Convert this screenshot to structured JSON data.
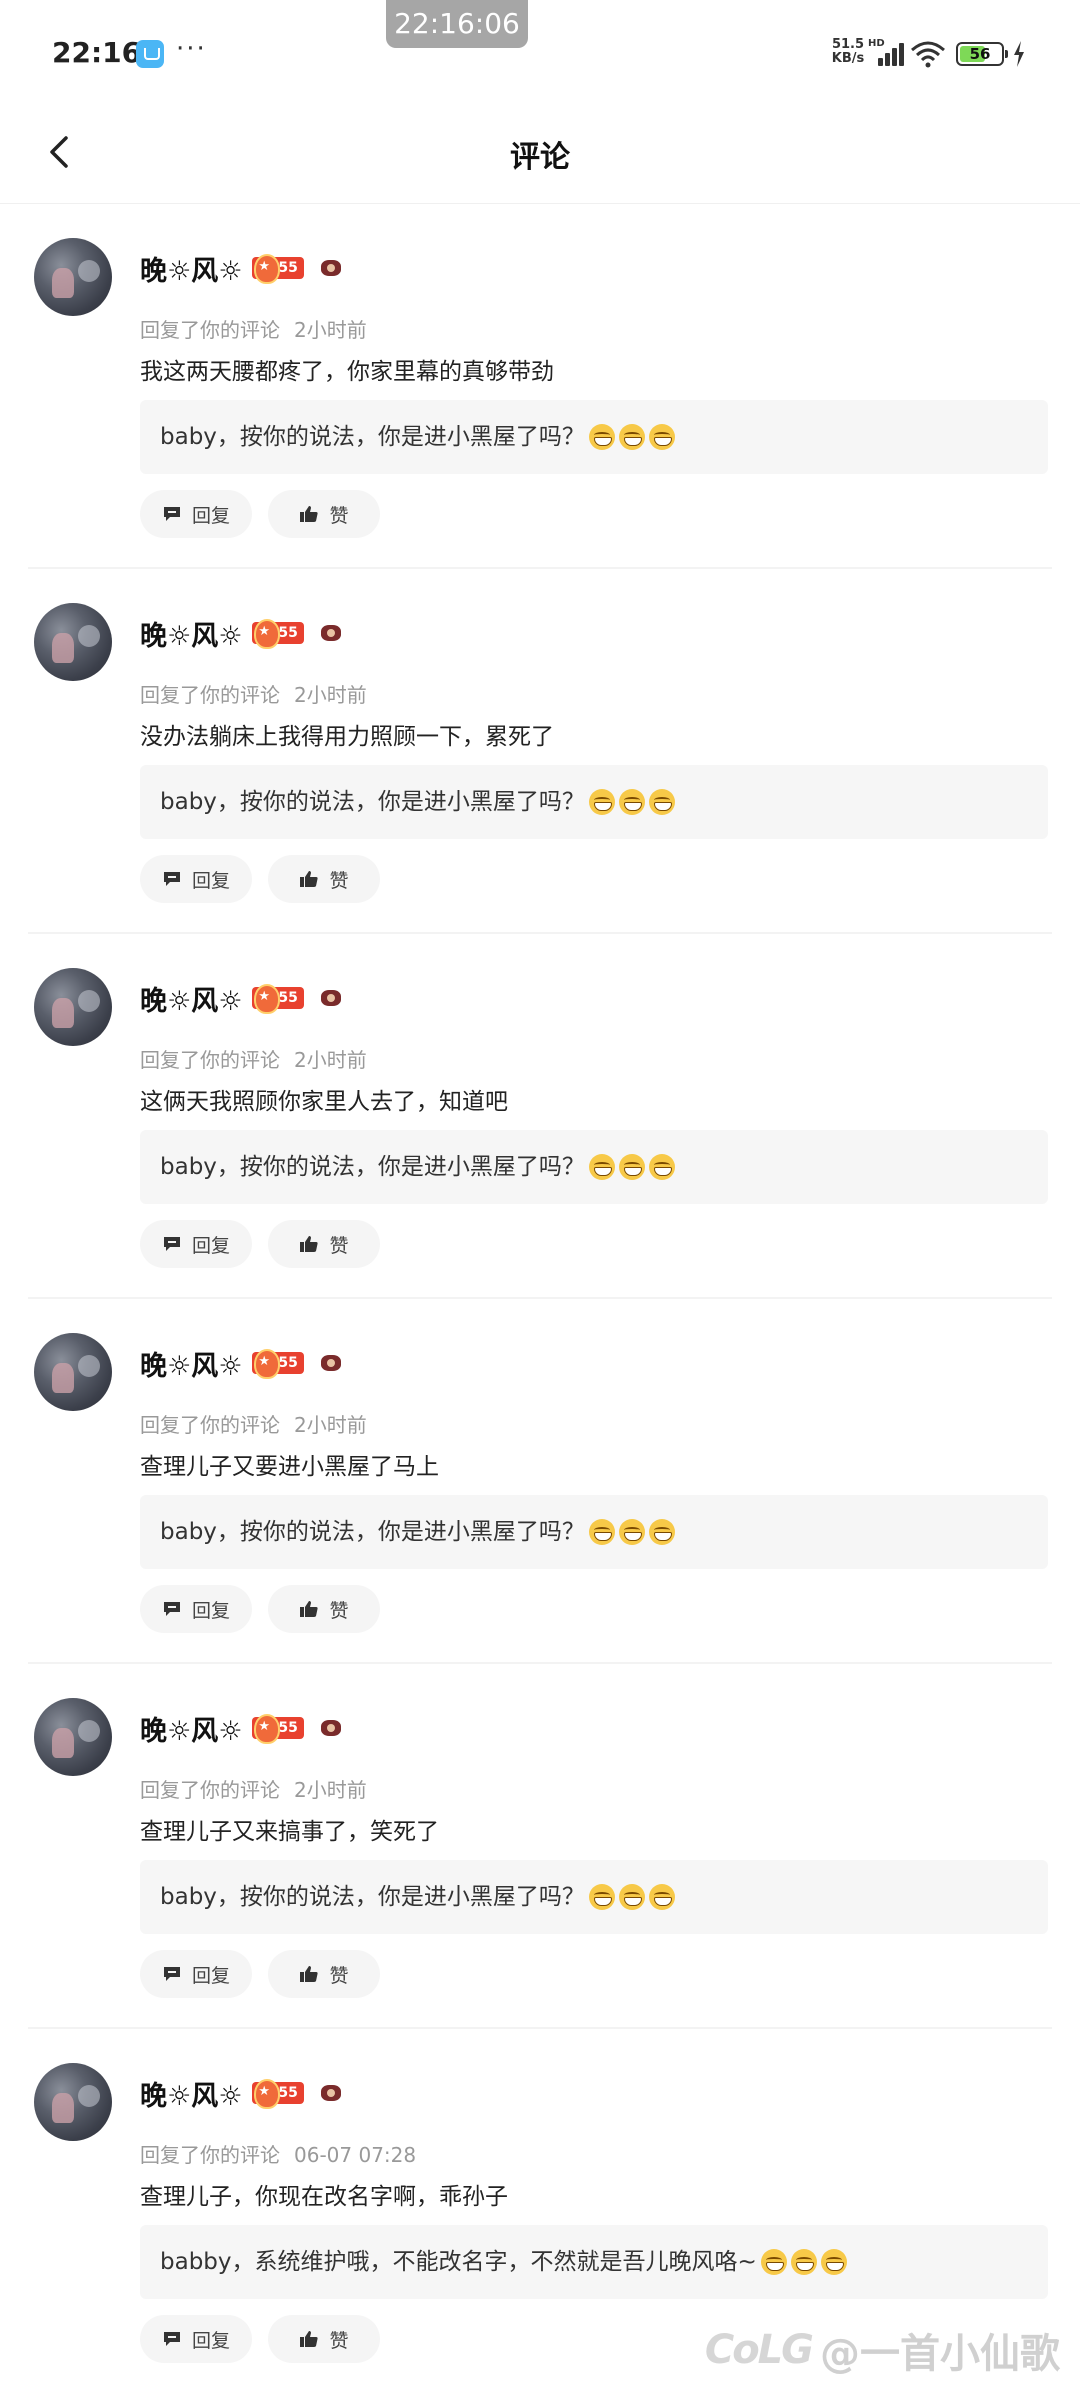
{
  "status_bar": {
    "time": "22:16",
    "overlay_time": "22:16:06",
    "more": "···",
    "net_speed": "51.5",
    "net_unit": "KB/s",
    "hd": "HD",
    "battery": "56"
  },
  "header": {
    "title": "评论"
  },
  "labels": {
    "reply": "回复",
    "like": "赞"
  },
  "comments": [
    {
      "username": "晚☼风☼",
      "level": "55",
      "meta": "回复了你的评论",
      "time": "2小时前",
      "text": "我这两天腰都疼了，你家里幕的真够带劲",
      "quote": "baby，按你的说法，你是进小黑屋了吗？"
    },
    {
      "username": "晚☼风☼",
      "level": "55",
      "meta": "回复了你的评论",
      "time": "2小时前",
      "text": "没办法躺床上我得用力照顾一下，累死了",
      "quote": "baby，按你的说法，你是进小黑屋了吗？"
    },
    {
      "username": "晚☼风☼",
      "level": "55",
      "meta": "回复了你的评论",
      "time": "2小时前",
      "text": "这俩天我照顾你家里人去了，知道吧",
      "quote": "baby，按你的说法，你是进小黑屋了吗？"
    },
    {
      "username": "晚☼风☼",
      "level": "55",
      "meta": "回复了你的评论",
      "time": "2小时前",
      "text": "查理儿子又要进小黑屋了马上",
      "quote": "baby，按你的说法，你是进小黑屋了吗？"
    },
    {
      "username": "晚☼风☼",
      "level": "55",
      "meta": "回复了你的评论",
      "time": "2小时前",
      "text": "查理儿子又来搞事了，笑死了",
      "quote": "baby，按你的说法，你是进小黑屋了吗？"
    },
    {
      "username": "晚☼风☼",
      "level": "55",
      "meta": "回复了你的评论",
      "time": "06-07 07:28",
      "text": "查理儿子，你现在改名字啊，乖孙子",
      "quote": "babby，系统维护哦，不能改名字，不然就是吾儿晚风咯~"
    }
  ],
  "watermark": {
    "logo": "CoLG",
    "text": "@一首小仙歌"
  },
  "colors": {
    "level_badge": "#e8412f",
    "battery": "#7ed957",
    "quote_bg": "#f6f6f6"
  }
}
